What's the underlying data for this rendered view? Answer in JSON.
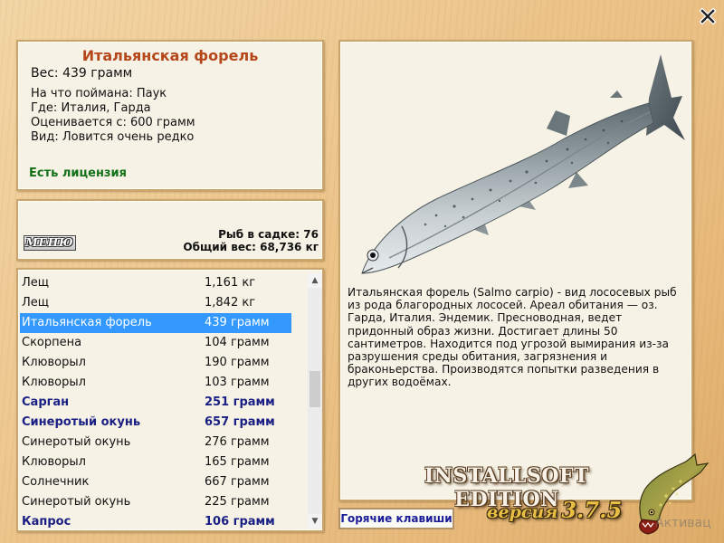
{
  "info": {
    "title": "Итальянская форель",
    "weight_label": "Вес:",
    "weight_value": "439 грамм",
    "caught_label": "На что поймана:",
    "caught_value": "Паук",
    "where_label": "Где:",
    "where_value": "Италия, Гарда",
    "price_label": "Оценивается с:",
    "price_value": "600 грамм",
    "rarity_label": "Вид:",
    "rarity_value": "Ловится очень редко",
    "license": "Есть лицензия"
  },
  "stats": {
    "menu_label": "МЕНЮ",
    "fish_count_label": "Рыб в садке:",
    "fish_count": "76",
    "total_weight_label": "Общий вес:",
    "total_weight": "68,736 кг"
  },
  "catch_list": {
    "selected_index": 2,
    "rows": [
      {
        "name": "Лещ",
        "weight": "1,161 кг",
        "style": "normal"
      },
      {
        "name": "Лещ",
        "weight": "1,842 кг",
        "style": "normal"
      },
      {
        "name": "Итальянская форель",
        "weight": "439 грамм",
        "style": "selected"
      },
      {
        "name": "Скорпена",
        "weight": "104 грамм",
        "style": "normal"
      },
      {
        "name": "Клюворыл",
        "weight": "190 грамм",
        "style": "normal"
      },
      {
        "name": "Клюворыл",
        "weight": "103 грамм",
        "style": "normal"
      },
      {
        "name": "Сарган",
        "weight": "251 грамм",
        "style": "bold"
      },
      {
        "name": "Синеротый окунь",
        "weight": "657 грамм",
        "style": "bold"
      },
      {
        "name": "Синеротый окунь",
        "weight": "276 грамм",
        "style": "normal"
      },
      {
        "name": "Клюворыл",
        "weight": "165 грамм",
        "style": "normal"
      },
      {
        "name": "Солнечник",
        "weight": "667 грамм",
        "style": "normal"
      },
      {
        "name": "Синеротый окунь",
        "weight": "225 грамм",
        "style": "normal"
      },
      {
        "name": "Капрос",
        "weight": "106 грамм",
        "style": "bold"
      }
    ],
    "scroll_position": 0.4
  },
  "detail": {
    "fish_image": "rainbow-trout",
    "description": "Итальянская форель (Salmo carpio) - вид лососевых рыб из рода благородных лососей. Ареал обитания — оз. Гарда, Италия. Эндемик. Пресноводная, ведет придонный образ жизни. Достигает длины 50 сантиметров. Находится под угрозой вымирания из-за разрушения среды обитания, загрязнения и браконьерства. Производятся попытки разведения в других водоёмах."
  },
  "hotkeys_label": "Горячие клавиши",
  "close_icon": "close-x",
  "branding": {
    "edition": "INSTALLSOFT EDITION",
    "version_label": "версия",
    "version_number": "3.7.5",
    "logo": "pike-fish"
  },
  "watermark": "Активац",
  "colors": {
    "title": "#b5471a",
    "license": "#137018",
    "selected_row": "#3399ff",
    "bold_row": "#1a1f84",
    "panel": "#f6f2e5",
    "panel_border": "#c9a56e",
    "hotkeys_text": "#1c1c99"
  }
}
